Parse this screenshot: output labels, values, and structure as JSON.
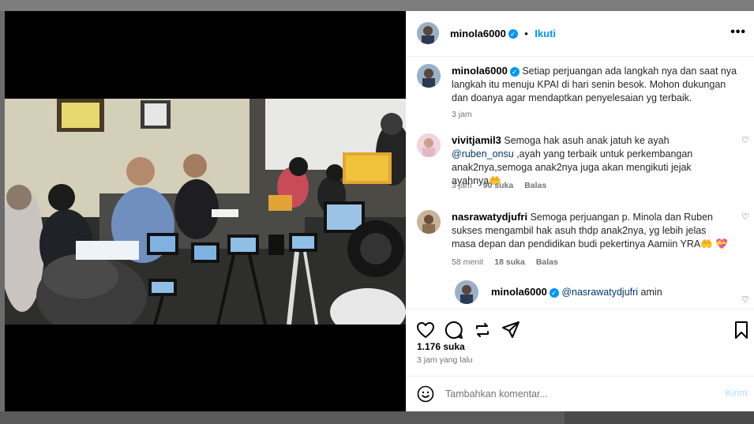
{
  "post": {
    "username": "minola6000",
    "follow_label": "Ikuti",
    "more_label": "•••",
    "caption": "Setiap perjuangan ada langkah nya dan saat nya langkah itu menuju KPAI di hari senin besok. Mohon dukungan dan doanya agar mendaptkan penyelesaian yg terbaik.",
    "caption_time": "3 jam"
  },
  "comments": [
    {
      "username": "vivitjamil3",
      "mention": "@ruben_onsu",
      "text_before": "Semoga hak asuh anak jatuh ke ayah ",
      "text_after": " ,ayah yang terbaik untuk perkembangan anak2nya,semoga anak2nya juga akan mengikuti jejak ayahnya🤲",
      "time": "3 jam",
      "likes": "90 suka",
      "reply": "Balas"
    },
    {
      "username": "nasrawatydjufri",
      "text": "Semoga perjuangan p. Minola dan Ruben sukses mengambil hak asuh thdp anak2nya, yg lebih jelas masa depan dan pendidikan budi pekertinya Aamiin YRA🤲 💝",
      "time": "58 menit",
      "likes": "18 suka",
      "reply": "Balas"
    },
    {
      "username": "minola6000",
      "mention": "@nasrawatydjufri",
      "text_after": " amin"
    }
  ],
  "stats": {
    "likes": "1.176 suka",
    "time_ago": "3 jam yang lalu"
  },
  "add_comment": {
    "placeholder": "Tambahkan komentar...",
    "post_label": "Kirim"
  },
  "icons": [
    "heart-icon",
    "comment-icon",
    "share-icon",
    "send-icon",
    "bookmark-icon",
    "emoji-icon",
    "verified-icon",
    "more-icon"
  ],
  "colors": {
    "accent": "#0095f6",
    "mention": "#00376b",
    "muted": "#737373",
    "post_disabled": "#b2dffc"
  }
}
